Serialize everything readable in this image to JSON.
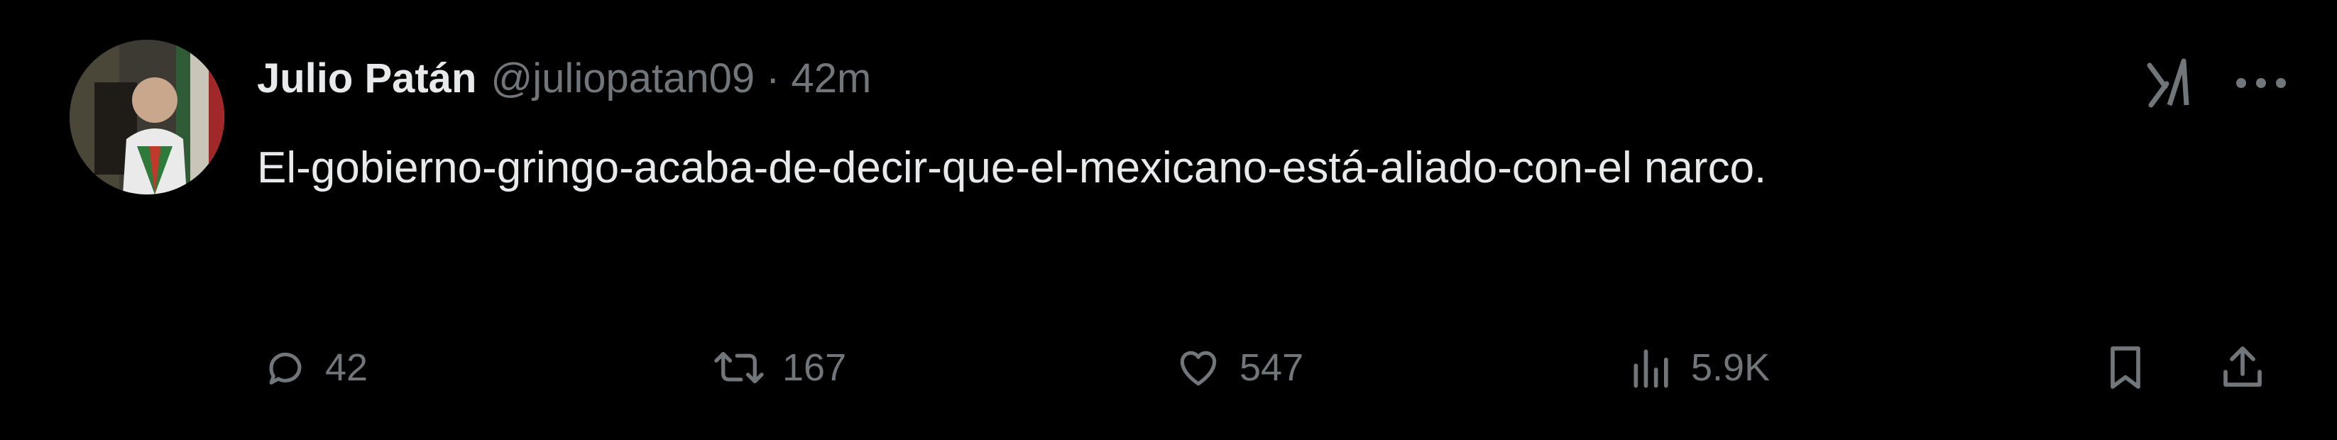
{
  "tweet": {
    "author_name": "Julio Patán",
    "author_handle": "@juliopatan09",
    "separator": "·",
    "time": "42m",
    "text": "El-gobierno-gringo-acaba-de-decir-que-el-mexicano-está-aliado-con-el narco."
  },
  "actions": {
    "replies": "42",
    "retweets": "167",
    "likes": "547",
    "views": "5.9K"
  },
  "icons": {
    "avatar": "avatar",
    "grok": "grok-icon",
    "more": "more-icon",
    "reply": "reply-icon",
    "retweet": "retweet-icon",
    "like": "heart-icon",
    "views": "views-icon",
    "bookmark": "bookmark-icon",
    "share": "share-icon"
  },
  "colors": {
    "background": "#000000",
    "primary_text": "#e7e9ea",
    "secondary_text": "#71767b"
  }
}
